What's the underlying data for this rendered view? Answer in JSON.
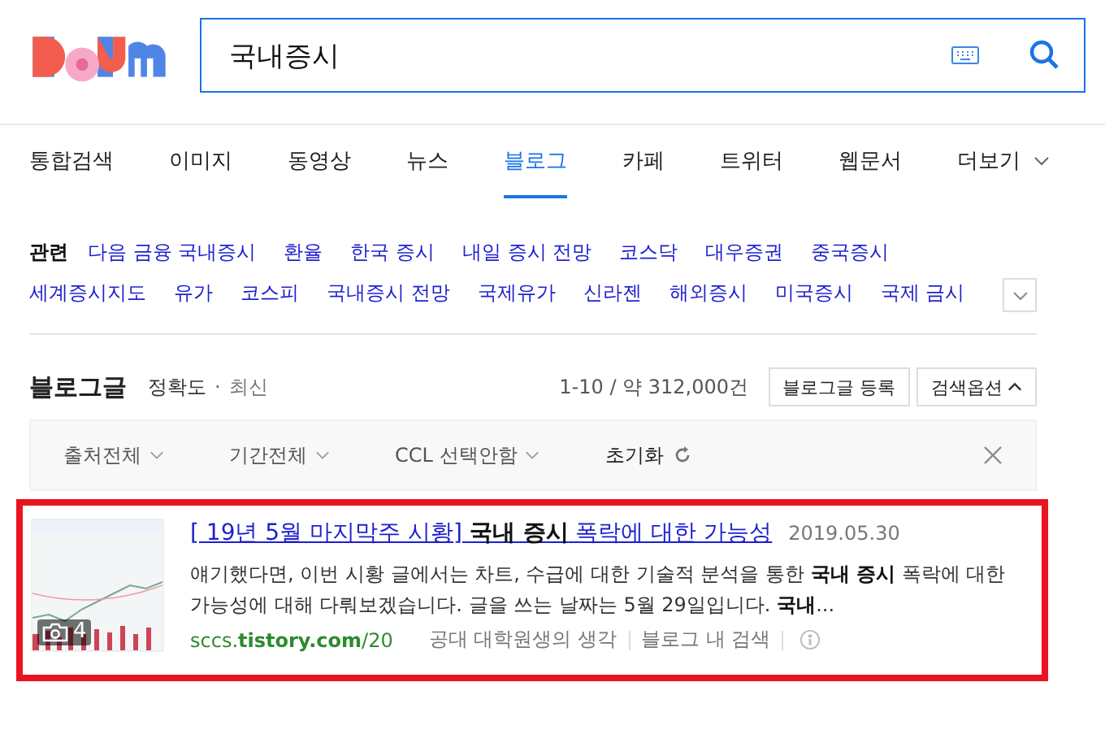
{
  "search": {
    "value": "국내증시"
  },
  "tabs": [
    {
      "label": "통합검색",
      "selected": false
    },
    {
      "label": "이미지",
      "selected": false
    },
    {
      "label": "동영상",
      "selected": false
    },
    {
      "label": "뉴스",
      "selected": false
    },
    {
      "label": "블로그",
      "selected": true
    },
    {
      "label": "카페",
      "selected": false
    },
    {
      "label": "트위터",
      "selected": false
    },
    {
      "label": "웹문서",
      "selected": false
    },
    {
      "label": "더보기",
      "selected": false,
      "kind": "more"
    }
  ],
  "related": {
    "label": "관련",
    "links": [
      "다음 금융 국내증시",
      "환율",
      "한국 증시",
      "내일 증시 전망",
      "코스닥",
      "대우증권",
      "중국증시",
      "세계증시지도",
      "유가",
      "코스피",
      "국내증시 전망",
      "국제유가",
      "신라젠",
      "해외증시",
      "미국증시",
      "국제 금시"
    ]
  },
  "blog": {
    "heading": "블로그글",
    "sort_separator": "·",
    "sort": [
      {
        "label": "정확도",
        "selected": true
      },
      {
        "label": "최신",
        "selected": false
      }
    ],
    "count": "1-10 / 약 312,000건",
    "buttons": [
      "블로그글 등록",
      "검색옵션"
    ]
  },
  "filters": [
    {
      "label": "출처전체",
      "kind": "dropdown"
    },
    {
      "label": "기간전체",
      "kind": "dropdown"
    },
    {
      "label": "CCL 선택안함",
      "kind": "dropdown"
    },
    {
      "label": "초기화",
      "kind": "reset"
    }
  ],
  "result": {
    "image_count": "4",
    "title": "[ 19년 5월 마지막주 시황] **국내 증시** 폭락에 대한 가능성",
    "date": "2019.05.30",
    "snippet": "얘기했다면, 이번 시황 글에서는 차트, 수급에 대한 기술적 분석을 통한 **국내 증시** 폭락에 대한 가능성에 대해 다뤄보겠습니다. 글을 쓰는 날짜는 5월 29일입니다. **국내**...",
    "url": "sccs.**tistory.com**/20",
    "source": "공대 대학원생의 생각",
    "search_in": "블로그 내 검색"
  }
}
